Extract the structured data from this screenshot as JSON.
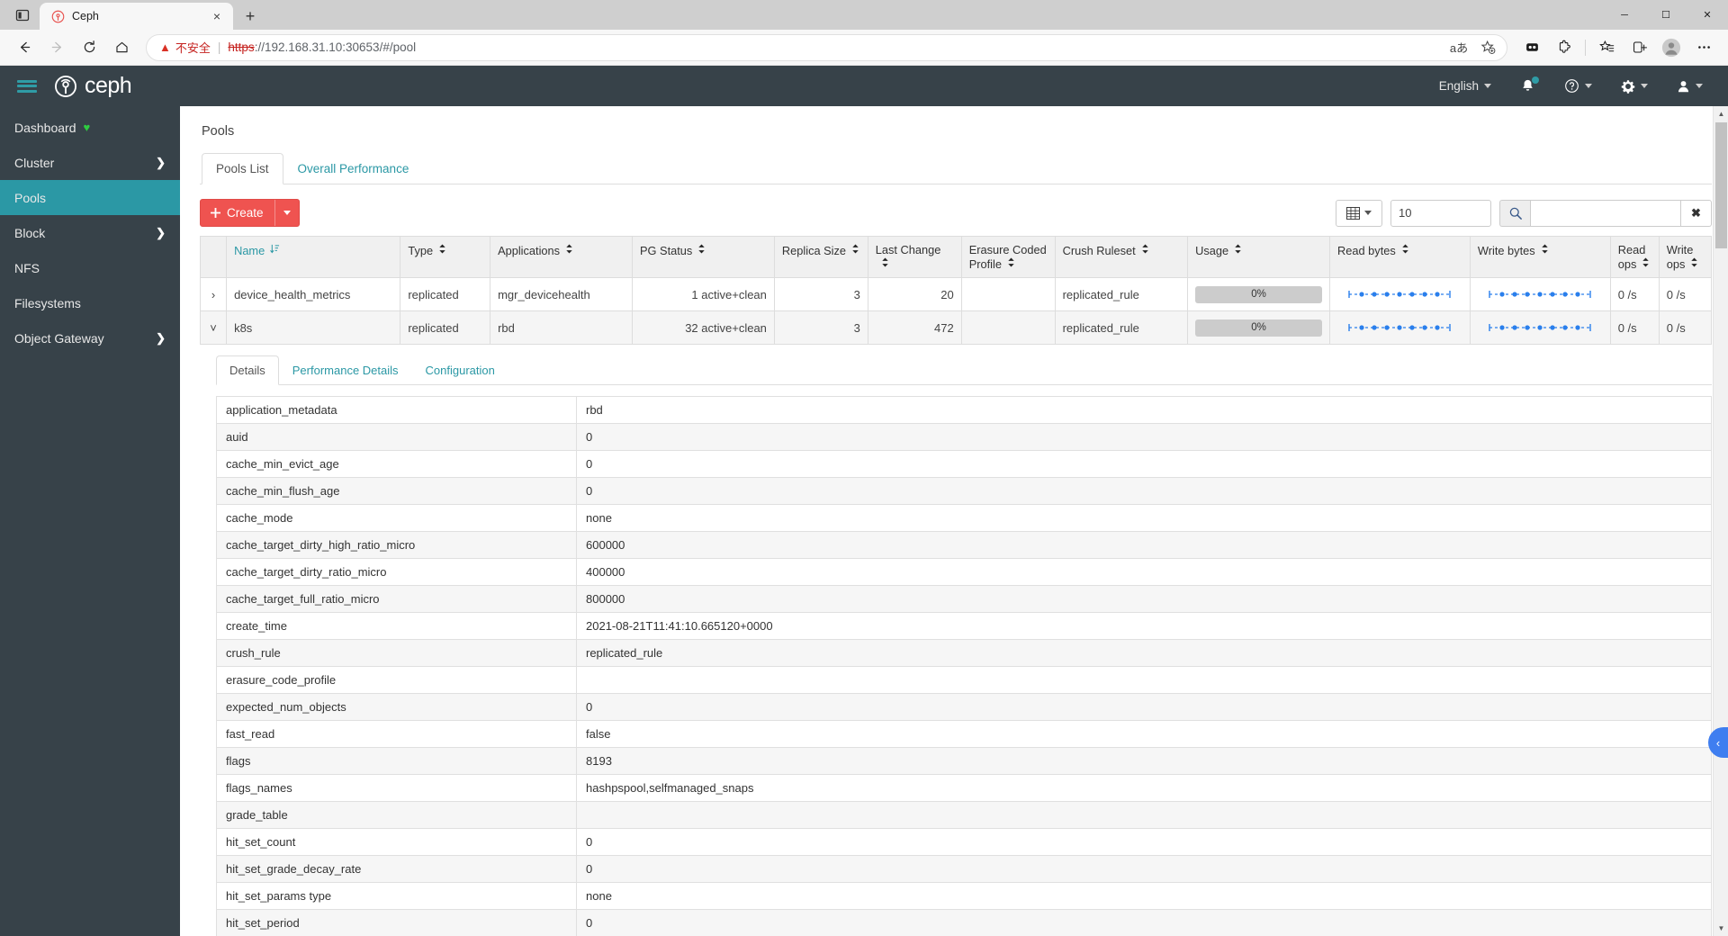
{
  "browser": {
    "tab": {
      "title": "Ceph",
      "favicon": "ceph-favicon",
      "close": "×"
    },
    "newtab_label": "+",
    "window_controls": [
      "—",
      "❐",
      "✕"
    ],
    "nav": {
      "back": "←",
      "forward": "→",
      "reload": "⟳",
      "home": "⌂"
    },
    "omnibox": {
      "warning_icon": "warning-triangle",
      "warning_text": "不安全",
      "separator": "|",
      "url_scheme": "https",
      "url_rest": "://192.168.31.10:30653/#/pool",
      "url_host": "192.168.31.10",
      "url_port": ":30653",
      "url_path": "/#/pool",
      "read_aloud_icon": "aあ",
      "favorite_icon": "star-plus-icon"
    },
    "toolbar_icons": [
      "collections-icon",
      "extensions-icon",
      "favorites-icon",
      "split-screen-icon",
      "profile-avatar-icon",
      "settings-more-icon"
    ]
  },
  "topbar": {
    "menu_icon": "hamburger-icon",
    "brand": "ceph",
    "language": "English",
    "notifications_icon": "bell-icon",
    "help_icon": "help-circle-icon",
    "settings_icon": "gear-icon",
    "user_icon": "user-icon"
  },
  "sidebar": {
    "items": [
      {
        "label": "Dashboard",
        "badge": "heart",
        "chevron": false,
        "active": false
      },
      {
        "label": "Cluster",
        "badge": "",
        "chevron": true,
        "active": false
      },
      {
        "label": "Pools",
        "badge": "",
        "chevron": false,
        "active": true
      },
      {
        "label": "Block",
        "badge": "",
        "chevron": true,
        "active": false
      },
      {
        "label": "NFS",
        "badge": "",
        "chevron": false,
        "active": false
      },
      {
        "label": "Filesystems",
        "badge": "",
        "chevron": false,
        "active": false
      },
      {
        "label": "Object Gateway",
        "badge": "",
        "chevron": true,
        "active": false
      }
    ]
  },
  "page": {
    "title": "Pools",
    "tabs": [
      {
        "label": "Pools List",
        "active": true
      },
      {
        "label": "Overall Performance",
        "active": false
      }
    ]
  },
  "toolbar": {
    "create_label": "Create",
    "create_plus": "➕",
    "column_selector_icon": "table-columns-icon",
    "limit_value": "10",
    "search_icon": "search-icon",
    "search_value": "",
    "search_placeholder": "",
    "clear_icon": "✖"
  },
  "pools_table": {
    "columns": [
      {
        "label": "Name",
        "sortable": true,
        "sorted": true
      },
      {
        "label": "Type",
        "sortable": true,
        "sorted": false
      },
      {
        "label": "Applications",
        "sortable": true,
        "sorted": false
      },
      {
        "label": "PG Status",
        "sortable": true,
        "sorted": false
      },
      {
        "label": "Replica Size",
        "sortable": true,
        "sorted": false
      },
      {
        "label": "Last Change",
        "sortable": true,
        "sorted": false
      },
      {
        "label": "Erasure Coded Profile",
        "sortable": true,
        "sorted": false
      },
      {
        "label": "Crush Ruleset",
        "sortable": true,
        "sorted": false
      },
      {
        "label": "Usage",
        "sortable": true,
        "sorted": false
      },
      {
        "label": "Read bytes",
        "sortable": true,
        "sorted": false
      },
      {
        "label": "Write bytes",
        "sortable": true,
        "sorted": false
      },
      {
        "label": "Read ops",
        "sortable": true,
        "sorted": false
      },
      {
        "label": "Write ops",
        "sortable": true,
        "sorted": false
      }
    ],
    "rows": [
      {
        "expander": "›",
        "expanded": false,
        "name": "device_health_metrics",
        "type": "replicated",
        "applications": "mgr_devicehealth",
        "pg_status": "1 active+clean",
        "replica_size": "3",
        "last_change": "20",
        "erasure_coded_profile": "",
        "crush_ruleset": "replicated_rule",
        "usage": "0%",
        "read_bytes": "sparkline",
        "write_bytes": "sparkline",
        "read_ops": "0 /s",
        "write_ops": "0 /s"
      },
      {
        "expander": "˅",
        "expanded": true,
        "name": "k8s",
        "type": "replicated",
        "applications": "rbd",
        "pg_status": "32 active+clean",
        "replica_size": "3",
        "last_change": "472",
        "erasure_coded_profile": "",
        "crush_ruleset": "replicated_rule",
        "usage": "0%",
        "read_bytes": "sparkline",
        "write_bytes": "sparkline",
        "read_ops": "0 /s",
        "write_ops": "0 /s"
      }
    ]
  },
  "details": {
    "tabs": [
      {
        "label": "Details",
        "active": true
      },
      {
        "label": "Performance Details",
        "active": false
      },
      {
        "label": "Configuration",
        "active": false
      }
    ],
    "rows": [
      {
        "key": "application_metadata",
        "value": "rbd"
      },
      {
        "key": "auid",
        "value": "0"
      },
      {
        "key": "cache_min_evict_age",
        "value": "0"
      },
      {
        "key": "cache_min_flush_age",
        "value": "0"
      },
      {
        "key": "cache_mode",
        "value": "none"
      },
      {
        "key": "cache_target_dirty_high_ratio_micro",
        "value": "600000"
      },
      {
        "key": "cache_target_dirty_ratio_micro",
        "value": "400000"
      },
      {
        "key": "cache_target_full_ratio_micro",
        "value": "800000"
      },
      {
        "key": "create_time",
        "value": "2021-08-21T11:41:10.665120+0000"
      },
      {
        "key": "crush_rule",
        "value": "replicated_rule"
      },
      {
        "key": "erasure_code_profile",
        "value": ""
      },
      {
        "key": "expected_num_objects",
        "value": "0"
      },
      {
        "key": "fast_read",
        "value": "false"
      },
      {
        "key": "flags",
        "value": "8193"
      },
      {
        "key": "flags_names",
        "value": "hashpspool,selfmanaged_snaps"
      },
      {
        "key": "grade_table",
        "value": ""
      },
      {
        "key": "hit_set_count",
        "value": "0"
      },
      {
        "key": "hit_set_grade_decay_rate",
        "value": "0"
      },
      {
        "key": "hit_set_params type",
        "value": "none"
      },
      {
        "key": "hit_set_period",
        "value": "0"
      }
    ]
  },
  "colors": {
    "brand_dark": "#374249",
    "accent_teal": "#2b98a5",
    "create_red": "#ef5350",
    "status_green": "#2ecc40",
    "sparkline_blue": "#2a7fec"
  },
  "scrollbar": {
    "up_arrow": "▲",
    "down_arrow": "▼"
  },
  "fab": {
    "icon": "‹"
  }
}
